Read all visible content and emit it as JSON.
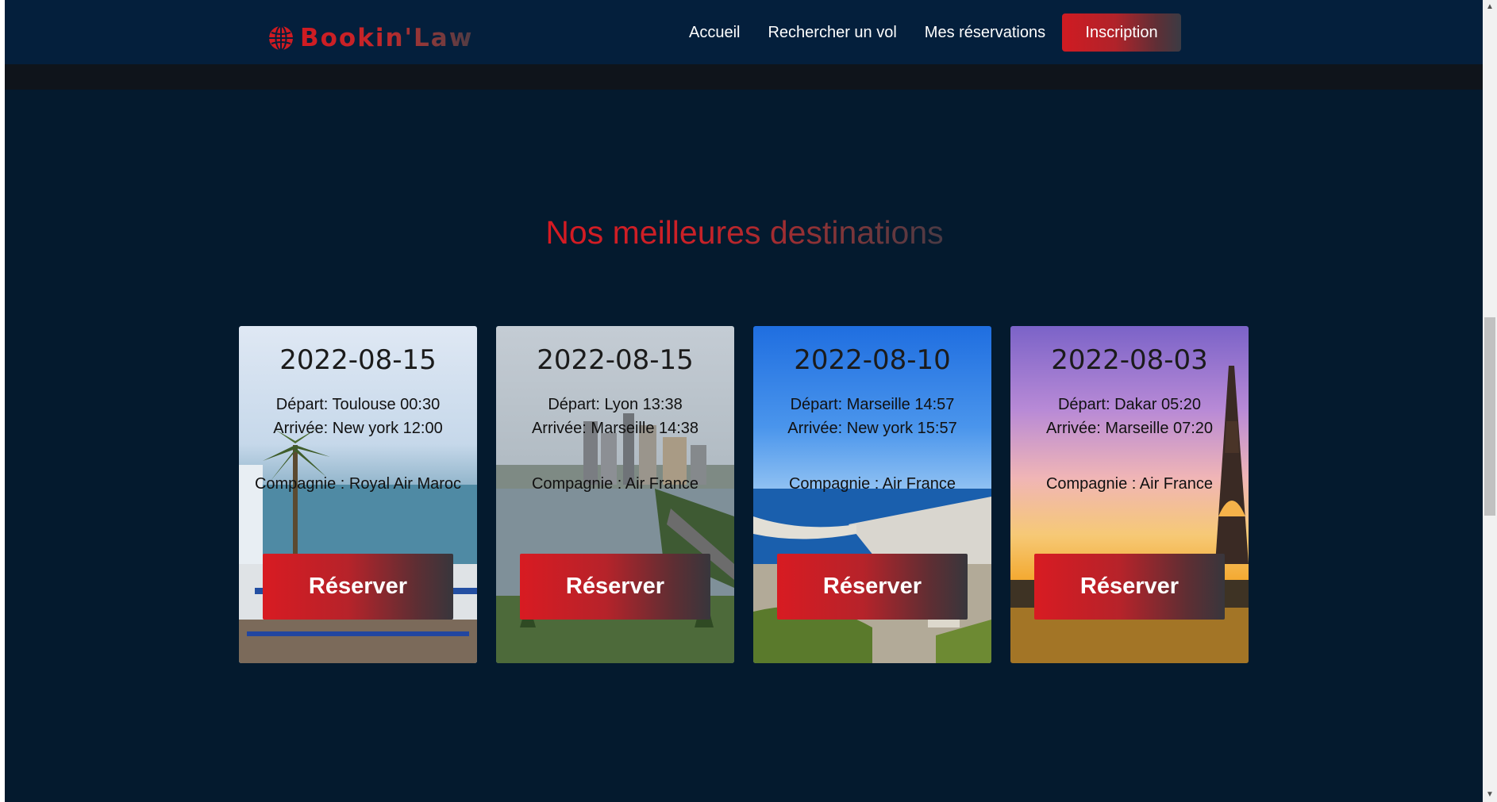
{
  "brand": {
    "name": "Bookin'Law",
    "icon": "globe-icon",
    "color": "#d01b22"
  },
  "nav": {
    "links": [
      "Accueil",
      "Rechercher un vol",
      "Mes réservations"
    ],
    "cta": "Inscription"
  },
  "section": {
    "title": "Nos meilleures destinations"
  },
  "cards": [
    {
      "date": "2022-08-15",
      "depart": "Départ: Toulouse 00:30",
      "arrivee": "Arrivée: New york 12:00",
      "company": "Compagnie : Royal Air Maroc",
      "button": "Réserver",
      "scene": "coastal town with palm tree and blue balconies"
    },
    {
      "date": "2022-08-15",
      "depart": "Départ: Lyon 13:38",
      "arrivee": "Arrivée: Marseille 14:38",
      "company": "Compagnie : Air France",
      "button": "Réserver",
      "scene": "city skyline over lagoon with palm trees"
    },
    {
      "date": "2022-08-10",
      "depart": "Départ: Marseille 14:57",
      "arrivee": "Arrivée: New york 15:57",
      "company": "Compagnie : Air France",
      "button": "Réserver",
      "scene": "blue sky over seaside city and coast"
    },
    {
      "date": "2022-08-03",
      "depart": "Départ: Dakar 05:20",
      "arrivee": "Arrivée: Marseille 07:20",
      "company": "Compagnie : Air France",
      "button": "Réserver",
      "scene": "eiffel tower at sunset"
    }
  ],
  "colors": {
    "background": "#041a2e",
    "navbar": "#041f3c",
    "accent": "#d01b22"
  }
}
